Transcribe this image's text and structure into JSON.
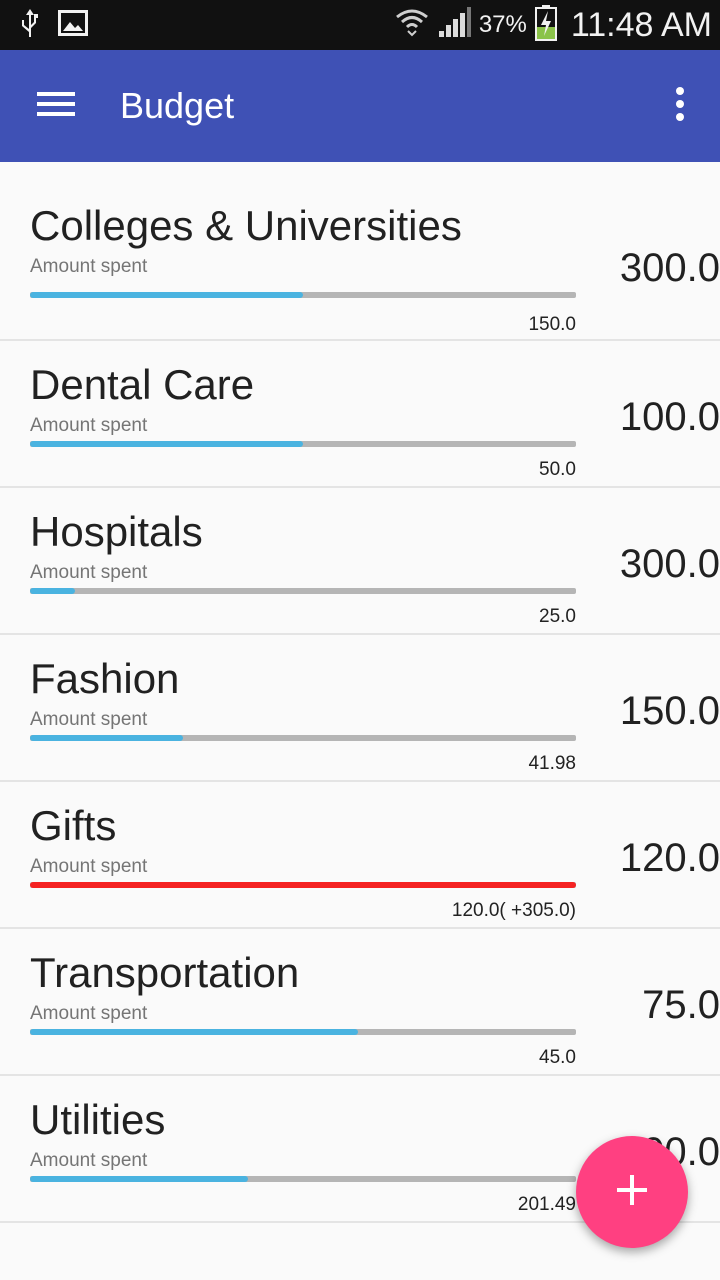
{
  "status_bar": {
    "usb_icon": "usb-icon",
    "image_icon": "image-icon",
    "wifi_icon": "wifi-icon",
    "signal_icon": "signal-icon",
    "battery_percent": "37%",
    "battery_icon": "battery-charging-icon",
    "time": "11:48 AM"
  },
  "app_bar": {
    "menu_icon": "menu-icon",
    "title": "Budget",
    "overflow_icon": "more-vert-icon",
    "color": "#3f51b5"
  },
  "budgets": [
    {
      "name": "Colleges & Universities",
      "label": "Amount spent",
      "spent": "150.0",
      "budget": "300.0",
      "progress": 0.5,
      "over": false
    },
    {
      "name": "Dental Care",
      "label": "Amount spent",
      "spent": "50.0",
      "budget": "100.0",
      "progress": 0.5,
      "over": false
    },
    {
      "name": "Hospitals",
      "label": "Amount spent",
      "spent": "25.0",
      "budget": "300.0",
      "progress": 0.083,
      "over": false
    },
    {
      "name": "Fashion",
      "label": "Amount spent",
      "spent": "41.98",
      "budget": "150.0",
      "progress": 0.28,
      "over": false
    },
    {
      "name": "Gifts",
      "label": "Amount spent",
      "spent": "120.0( +305.0)",
      "budget": "120.0",
      "progress": 1.0,
      "over": true
    },
    {
      "name": "Transportation",
      "label": "Amount spent",
      "spent": "45.0",
      "budget": "75.0",
      "progress": 0.6,
      "over": false
    },
    {
      "name": "Utilities",
      "label": "Amount spent",
      "spent": "201.49",
      "budget": "500.0",
      "progress": 0.4,
      "over": false
    }
  ],
  "colors": {
    "progress": "#4ab3e0",
    "over_budget": "#f52222",
    "track": "#b5b5b5",
    "fab": "#ff4081"
  },
  "fab": {
    "icon": "add-icon"
  }
}
